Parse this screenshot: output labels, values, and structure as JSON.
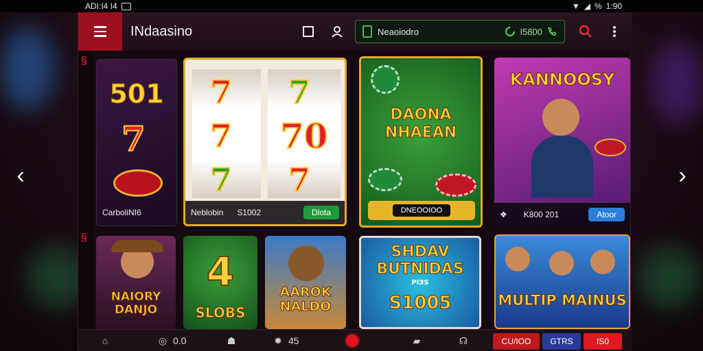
{
  "status_bar": {
    "left_text": "ADI:I4 I4",
    "time": "1:90",
    "battery_text": "%"
  },
  "header": {
    "app_title": "INdaasino",
    "wallet_label": "Neaoiodro",
    "balance": "I5800"
  },
  "cards_row1": [
    {
      "title": "501",
      "label": "CarboliNI6"
    },
    {
      "reel_values": [
        "7",
        "70"
      ],
      "label": "Neblobin",
      "amount": "S1002",
      "button": "Dlota"
    },
    {
      "title": "DAONA\nNHAEAN",
      "button": "DNEOOIOO"
    },
    {
      "title": "KANNOOSY",
      "amount": "K800 201",
      "button": "Atoor"
    }
  ],
  "cards_row2": [
    {
      "title": "NAIORY\nDANJO"
    },
    {
      "title": "SLOBS",
      "badge": "4"
    },
    {
      "title": "AAROK\nNALDO"
    },
    {
      "title": "SHDAV\nBUTNIDAS",
      "amount": "S1005",
      "sub": "PI3S"
    },
    {
      "title": "MULTIP MAINUS"
    }
  ],
  "bottom_bar": {
    "items": [
      "0.0",
      "45"
    ],
    "buttons": [
      "CU/IOO",
      "GTRS",
      "IS0"
    ]
  },
  "colors": {
    "accent": "#9b1020",
    "wallet_border": "#3f7a3c",
    "gold": "#e3a92a",
    "green_btn": "#1f9a3a",
    "blue_btn": "#2a7fd8"
  }
}
